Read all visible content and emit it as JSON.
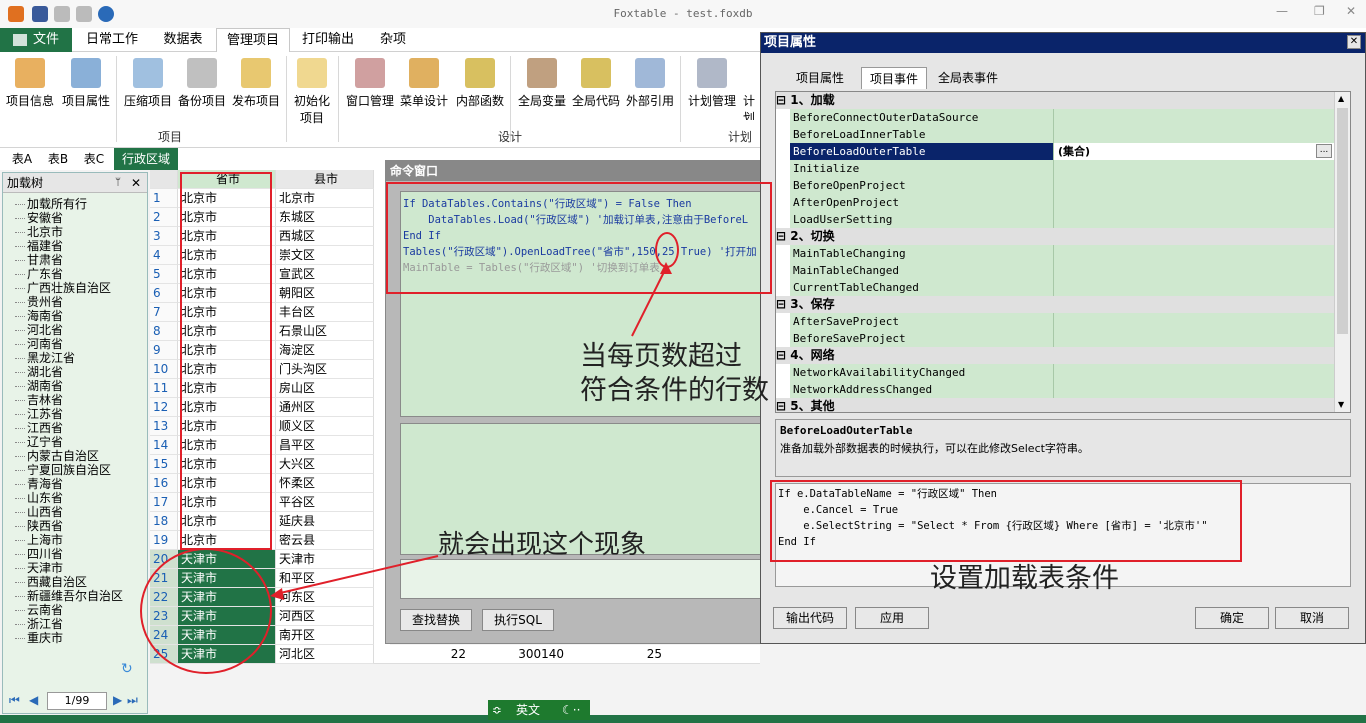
{
  "title": "Foxtable - test.foxdb",
  "menu": {
    "file": "文件",
    "tabs": [
      "日常工作",
      "数据表",
      "管理项目",
      "打印输出",
      "杂项"
    ]
  },
  "ribbon": {
    "buttons": [
      "项目信息",
      "项目属性",
      "压缩项目",
      "备份项目",
      "发布项目",
      "初始化项目",
      "窗口管理",
      "菜单设计",
      "内部函数",
      "全局变量",
      "全局代码",
      "外部引用",
      "计划管理",
      "计划"
    ],
    "groups": [
      "项目",
      "设计",
      "计划"
    ]
  },
  "table_tabs": [
    "表A",
    "表B",
    "表C",
    "行政区域"
  ],
  "tree": {
    "header": "加载树",
    "pin": "📌",
    "close": "✕",
    "items": [
      "加载所有行",
      "安徽省",
      "北京市",
      "福建省",
      "甘肃省",
      "广东省",
      "广西壮族自治区",
      "贵州省",
      "海南省",
      "河北省",
      "河南省",
      "黑龙江省",
      "湖北省",
      "湖南省",
      "吉林省",
      "江苏省",
      "江西省",
      "辽宁省",
      "内蒙古自治区",
      "宁夏回族自治区",
      "青海省",
      "山东省",
      "山西省",
      "陕西省",
      "上海市",
      "四川省",
      "天津市",
      "西藏自治区",
      "新疆维吾尔自治区",
      "云南省",
      "浙江省",
      "重庆市"
    ],
    "pager": "1/99"
  },
  "grid": {
    "col_province": "省市",
    "col_county": "县市",
    "rows": [
      [
        "1",
        "北京市",
        "北京市"
      ],
      [
        "2",
        "北京市",
        "东城区"
      ],
      [
        "3",
        "北京市",
        "西城区"
      ],
      [
        "4",
        "北京市",
        "崇文区"
      ],
      [
        "5",
        "北京市",
        "宣武区"
      ],
      [
        "6",
        "北京市",
        "朝阳区"
      ],
      [
        "7",
        "北京市",
        "丰台区"
      ],
      [
        "8",
        "北京市",
        "石景山区"
      ],
      [
        "9",
        "北京市",
        "海淀区"
      ],
      [
        "10",
        "北京市",
        "门头沟区"
      ],
      [
        "11",
        "北京市",
        "房山区"
      ],
      [
        "12",
        "北京市",
        "通州区"
      ],
      [
        "13",
        "北京市",
        "顺义区"
      ],
      [
        "14",
        "北京市",
        "昌平区"
      ],
      [
        "15",
        "北京市",
        "大兴区"
      ],
      [
        "16",
        "北京市",
        "怀柔区"
      ],
      [
        "17",
        "北京市",
        "平谷区"
      ],
      [
        "18",
        "北京市",
        "延庆县"
      ],
      [
        "19",
        "北京市",
        "密云县"
      ],
      [
        "20",
        "天津市",
        "天津市"
      ],
      [
        "21",
        "天津市",
        "和平区"
      ],
      [
        "22",
        "天津市",
        "河东区"
      ],
      [
        "23",
        "天津市",
        "河西区"
      ],
      [
        "24",
        "天津市",
        "南开区"
      ],
      [
        "25",
        "天津市",
        "河北区"
      ]
    ],
    "last_extra": [
      "22",
      "300140",
      "25"
    ]
  },
  "cmd": {
    "title": "命令窗口",
    "lines": [
      "If DataTables.Contains(\"行政区域\") = False Then",
      "    DataTables.Load(\"行政区域\") '加载订单表,注意由于BeforeL",
      "End If",
      "Tables(\"行政区域\").OpenLoadTree(\"省市\",150,25,True) '打开加",
      "MainTable = Tables(\"行政区域\") '切换到订单表"
    ],
    "find": "查找替换",
    "exec": "执行SQL"
  },
  "annotations": {
    "a1": "当每页数超过",
    "a2": "符合条件的行数",
    "a3": "就会出现这个现象",
    "a4": "设置加载表条件"
  },
  "prop": {
    "title": "项目属性",
    "tabs": [
      "项目属性",
      "项目事件",
      "全局表事件"
    ],
    "cats": [
      {
        "label": "1、加载",
        "items": [
          "BeforeConnectOuterDataSource",
          "BeforeLoadInnerTable",
          "BeforeLoadOuterTable",
          "Initialize",
          "BeforeOpenProject",
          "AfterOpenProject",
          "LoadUserSetting"
        ]
      },
      {
        "label": "2、切换",
        "items": [
          "MainTableChanging",
          "MainTableChanged",
          "CurrentTableChanged"
        ]
      },
      {
        "label": "3、保存",
        "items": [
          "AfterSaveProject",
          "BeforeSaveProject"
        ]
      },
      {
        "label": "4、网络",
        "items": [
          "NetworkAvailabilityChanged",
          "NetworkAddressChanged"
        ]
      },
      {
        "label": "5、其他",
        "items": []
      }
    ],
    "selected_value": "(集合)",
    "desc_title": "BeforeLoadOuterTable",
    "desc_text": "准备加载外部数据表的时候执行，可以在此修改Select字符串。",
    "code": [
      "If e.DataTableName = \"行政区域\" Then",
      "    e.Cancel = True",
      "    e.SelectString = \"Select * From {行政区域} Where [省市] = '北京市'\"",
      "End If"
    ],
    "buttons": {
      "export": "输出代码",
      "apply": "应用",
      "ok": "确定",
      "cancel": "取消"
    }
  },
  "ime": "英文",
  "colors": {
    "accent": "#217346",
    "select": "#0a246a",
    "grid_green": "#cfe8cf",
    "red": "#e0202a"
  }
}
